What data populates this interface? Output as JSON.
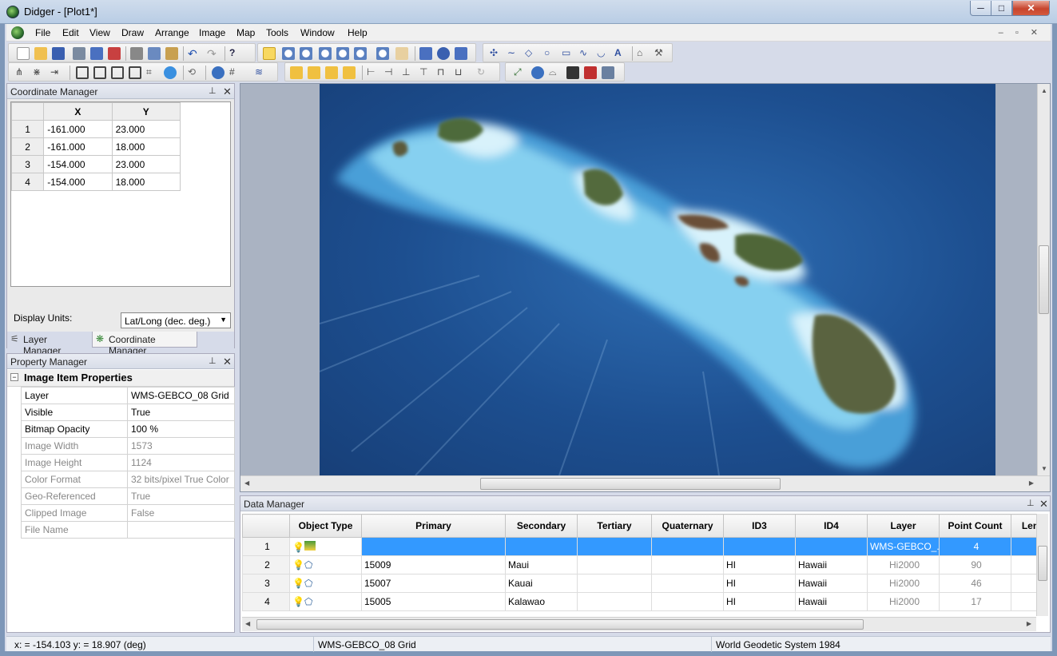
{
  "window": {
    "title": "Didger - [Plot1*]",
    "minimize": "─",
    "maximize": "□",
    "close": "✕"
  },
  "menu": {
    "items": [
      "File",
      "Edit",
      "View",
      "Draw",
      "Arrange",
      "Image",
      "Map",
      "Tools",
      "Window",
      "Help"
    ],
    "mdi_controls": "– ▫ ✕"
  },
  "coordinate_manager": {
    "title": "Coordinate Manager",
    "columns": [
      "X",
      "Y"
    ],
    "rows": [
      {
        "n": "1",
        "x": "-161.000",
        "y": "23.000"
      },
      {
        "n": "2",
        "x": "-161.000",
        "y": "18.000"
      },
      {
        "n": "3",
        "x": "-154.000",
        "y": "23.000"
      },
      {
        "n": "4",
        "x": "-154.000",
        "y": "18.000"
      }
    ],
    "display_units_label": "Display Units:",
    "display_units_value": "Lat/Long (dec. deg.)"
  },
  "tabs": {
    "layer_manager": "Layer Manager",
    "coordinate_manager": "Coordinate Manager"
  },
  "property_manager": {
    "title": "Property Manager",
    "section": "Image Item Properties",
    "rows": [
      {
        "label": "Layer",
        "value": "WMS-GEBCO_08 Grid",
        "enabled": true
      },
      {
        "label": "Visible",
        "value": "True",
        "enabled": true
      },
      {
        "label": "Bitmap Opacity",
        "value": "100 %",
        "enabled": true
      },
      {
        "label": "Image Width",
        "value": "1573",
        "enabled": false
      },
      {
        "label": "Image Height",
        "value": "1124",
        "enabled": false
      },
      {
        "label": "Color Format",
        "value": "32 bits/pixel True Color",
        "enabled": false
      },
      {
        "label": "Geo-Referenced",
        "value": "True",
        "enabled": false
      },
      {
        "label": "Clipped Image",
        "value": "False",
        "enabled": false
      },
      {
        "label": "File Name",
        "value": "",
        "enabled": false
      }
    ]
  },
  "data_manager": {
    "title": "Data Manager",
    "columns": [
      "Object Type",
      "Primary",
      "Secondary",
      "Tertiary",
      "Quaternary",
      "ID3",
      "ID4",
      "Layer",
      "Point Count",
      "Len"
    ],
    "rows": [
      {
        "n": "1",
        "type": "image",
        "primary": "",
        "secondary": "",
        "tertiary": "",
        "quaternary": "",
        "id3": "",
        "id4": "",
        "layer": "WMS-GEBCO_...",
        "count": "4"
      },
      {
        "n": "2",
        "type": "polygon",
        "primary": "15009",
        "secondary": "Maui",
        "tertiary": "",
        "quaternary": "",
        "id3": "HI",
        "id4": "Hawaii",
        "layer": "Hi2000",
        "count": "90"
      },
      {
        "n": "3",
        "type": "polygon",
        "primary": "15007",
        "secondary": "Kauai",
        "tertiary": "",
        "quaternary": "",
        "id3": "HI",
        "id4": "Hawaii",
        "layer": "Hi2000",
        "count": "46"
      },
      {
        "n": "4",
        "type": "polygon",
        "primary": "15005",
        "secondary": "Kalawao",
        "tertiary": "",
        "quaternary": "",
        "id3": "HI",
        "id4": "Hawaii",
        "layer": "Hi2000",
        "count": "17"
      }
    ]
  },
  "status": {
    "coords": "x: = -154.103 y: = 18.907 (deg)",
    "layer": "WMS-GEBCO_08 Grid",
    "datum": "World Geodetic System 1984"
  }
}
